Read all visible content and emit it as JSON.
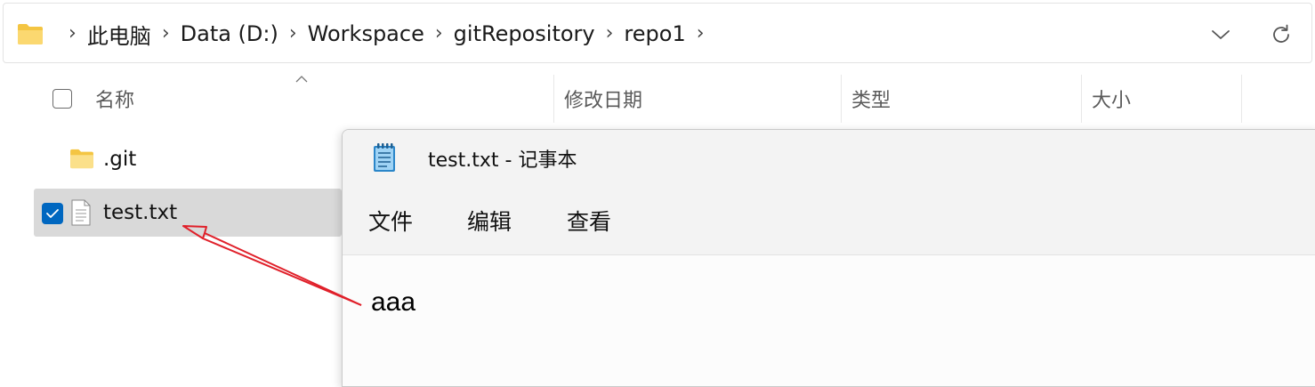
{
  "address_bar": {
    "breadcrumbs": [
      "此电脑",
      "Data (D:)",
      "Workspace",
      "gitRepository",
      "repo1"
    ],
    "icons": {
      "location": "folder-icon",
      "separator": "chevron-right-icon",
      "history": "chevron-down-icon",
      "refresh": "refresh-icon"
    }
  },
  "file_list": {
    "columns": [
      "名称",
      "修改日期",
      "类型",
      "大小"
    ],
    "sort_indicator": "sort-ascending-icon",
    "items": [
      {
        "name": ".git",
        "icon": "folder-icon",
        "selected": false
      },
      {
        "name": "test.txt",
        "icon": "text-file-icon",
        "selected": true
      }
    ]
  },
  "notepad": {
    "title": "test.txt - 记事本",
    "icon": "notepad-icon",
    "menu": [
      "文件",
      "编辑",
      "查看"
    ],
    "content": "aaa"
  },
  "annotation": {
    "color": "#e0202a"
  },
  "colors": {
    "accent": "#0067c0",
    "folder": "#f8d775",
    "selection": "#d9d9d9"
  }
}
